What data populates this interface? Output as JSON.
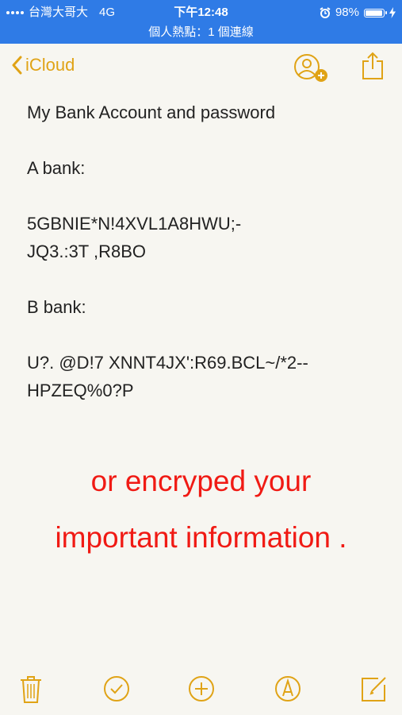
{
  "status_bar": {
    "carrier": "台灣大哥大",
    "network": "4G",
    "time": "下午12:48",
    "battery": "98%",
    "battery_level": 0.98,
    "hotspot": "個人熱點：1 個連線",
    "icons": [
      "signal-icon",
      "alarm-icon",
      "battery-icon",
      "charging-icon"
    ]
  },
  "nav": {
    "back_label": "iCloud",
    "icons": [
      "chevron-left-icon",
      "add-people-icon",
      "share-icon"
    ]
  },
  "note": {
    "title": "My Bank Account and password",
    "a_label": "A bank:",
    "a_line1": "5GBNIE*N!4XVL1A8HWU;-",
    "a_line2": "JQ3.:3T ,R8BO",
    "b_label": "B bank:",
    "b_line1": "U?. @D!7 XNNT4JX':R69.BCL~/*2--",
    "b_line2": "HPZEQ%0?P"
  },
  "overlay": {
    "line1": "or encryped your",
    "line2": "important information ."
  },
  "toolbar": {
    "icons": [
      "trash-icon",
      "checklist-icon",
      "add-icon",
      "markup-icon",
      "compose-icon"
    ]
  },
  "colors": {
    "accent": "#e0a316",
    "status_bar": "#2f7be6",
    "overlay_text": "#f01a14",
    "background": "#f7f6f1"
  }
}
